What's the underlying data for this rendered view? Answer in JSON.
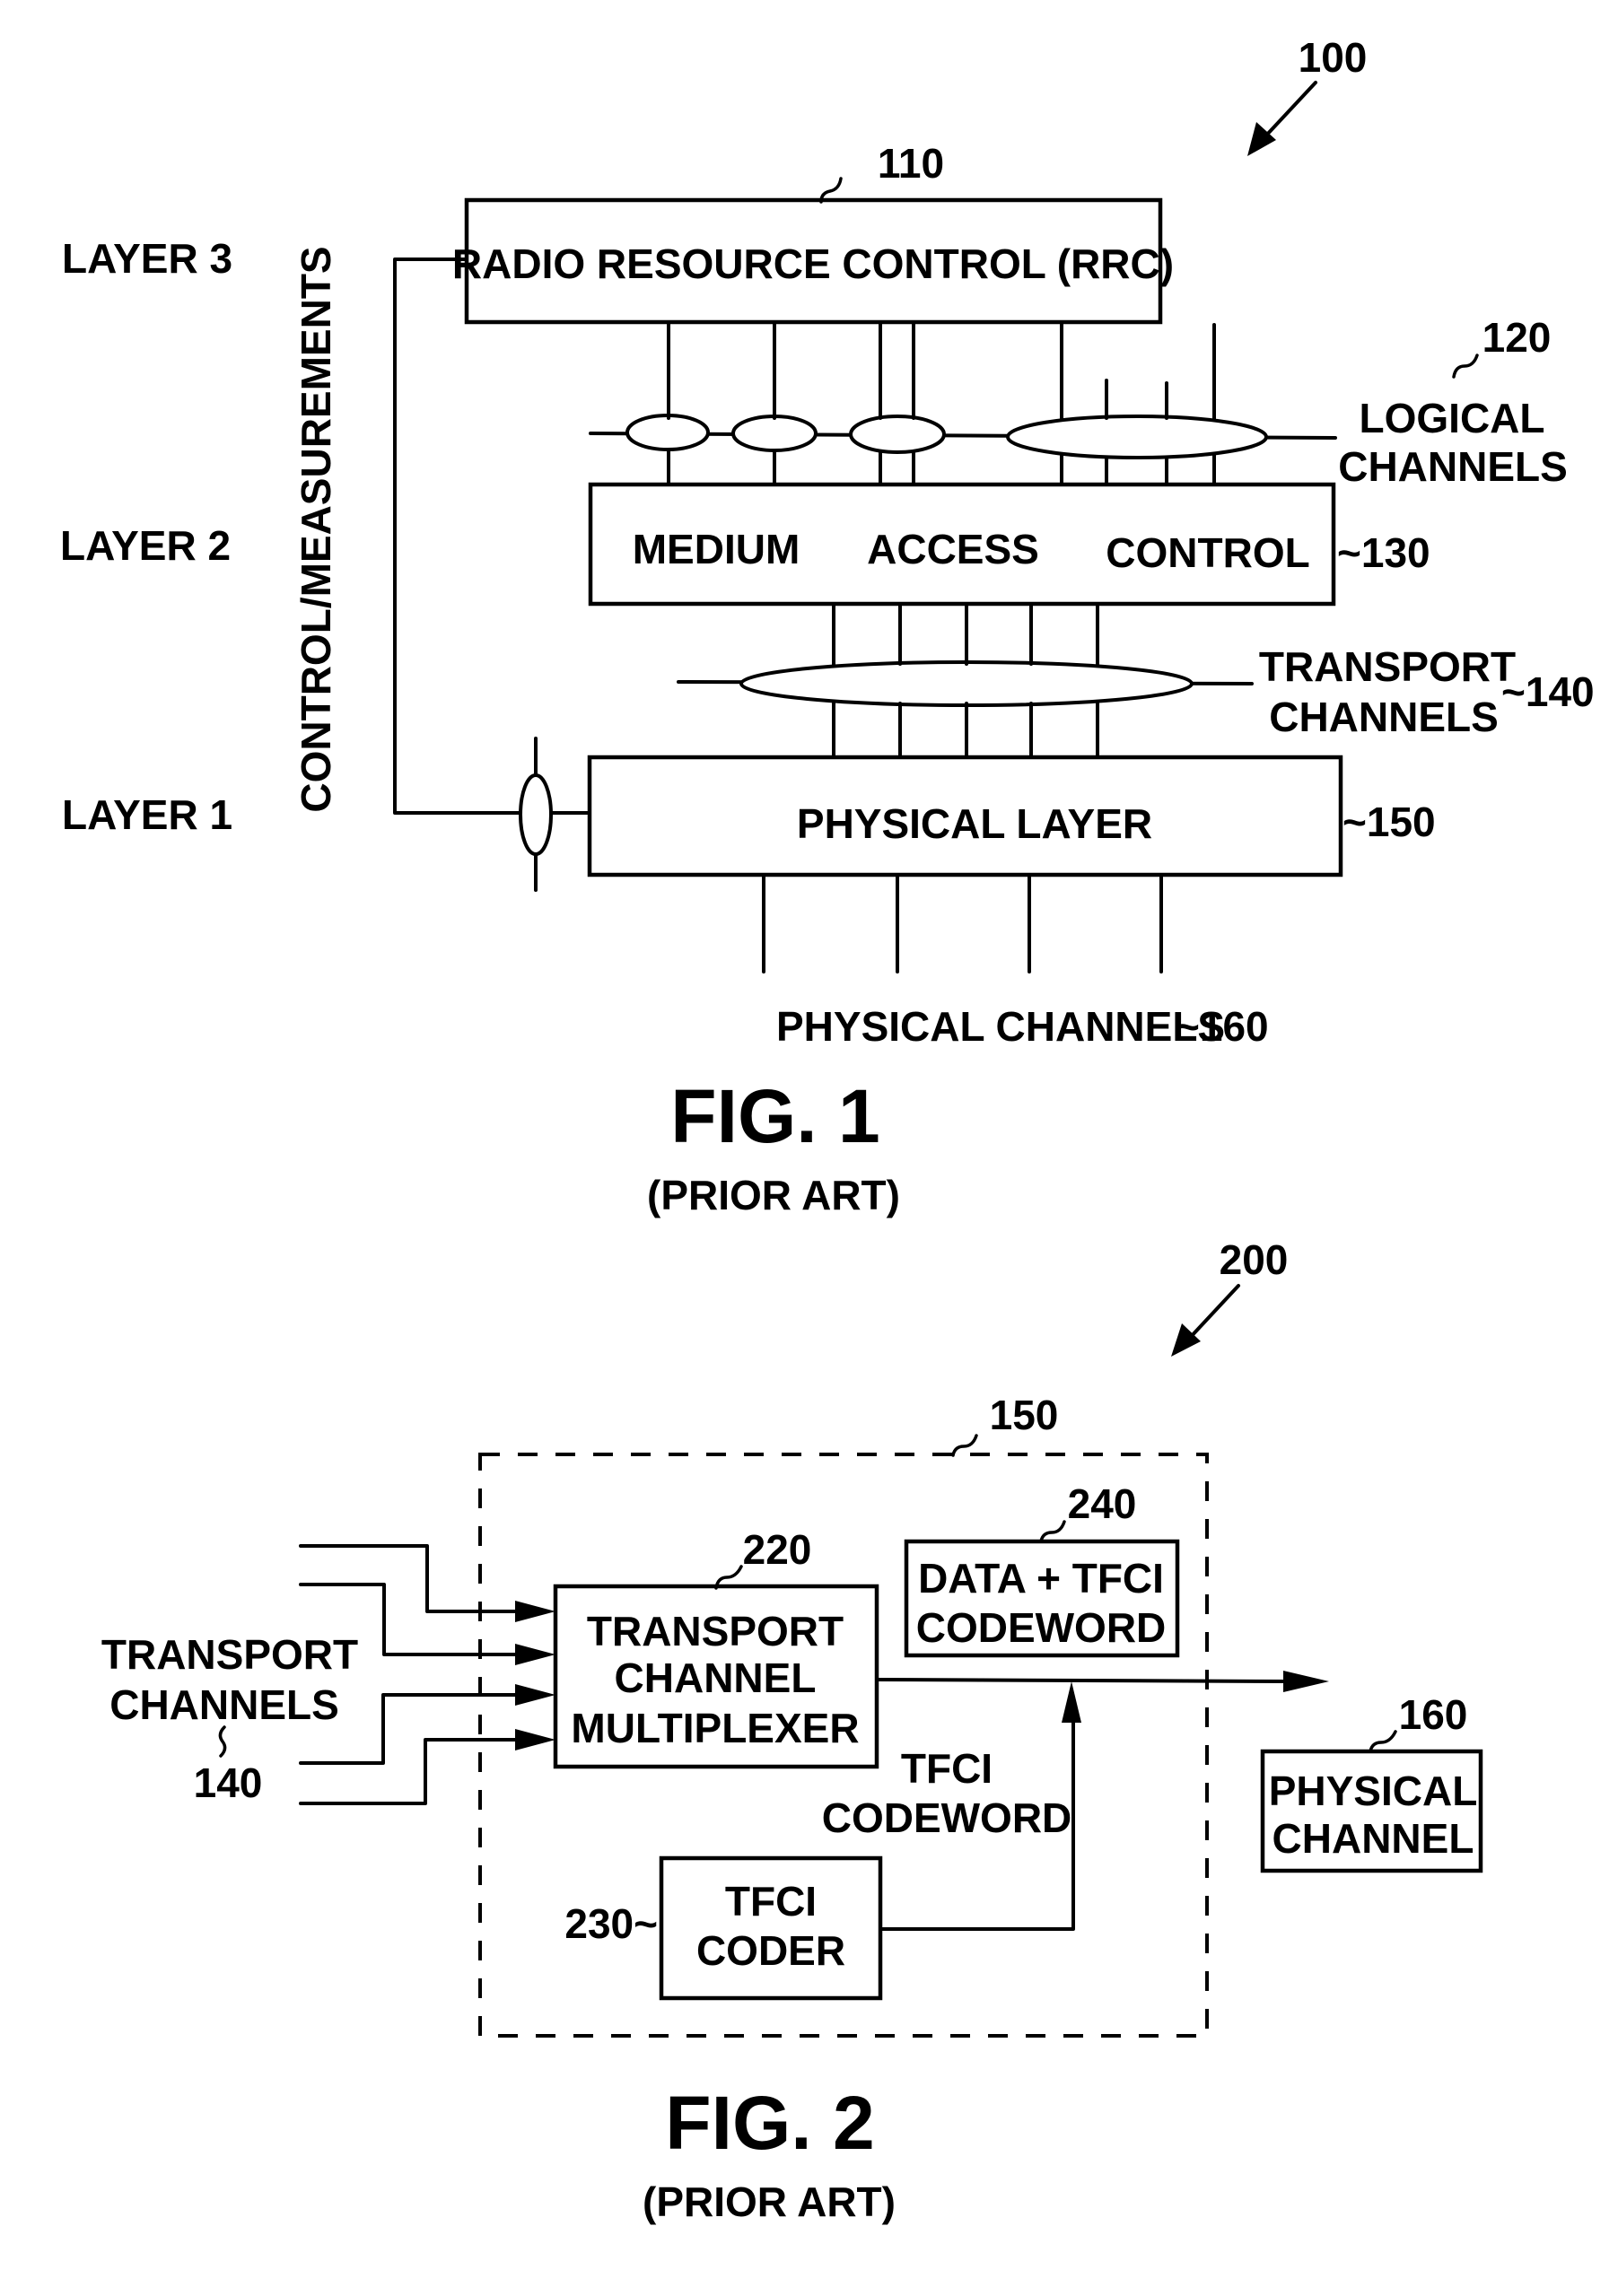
{
  "document": {
    "type": "patent drawing sheet",
    "colors": {
      "ink": "#000000",
      "paper": "#ffffff"
    }
  },
  "fig1": {
    "ref": "100",
    "layers": [
      "LAYER 3",
      "LAYER 2",
      "LAYER 1"
    ],
    "control_label": "CONTROL/MEASUREMENTS",
    "rrc": {
      "label": "RADIO RESOURCE CONTROL (RRC)",
      "ref": "110"
    },
    "logical_channels": {
      "line1": "LOGICAL",
      "line2": "CHANNELS",
      "ref": "120"
    },
    "mac": {
      "words": [
        "MEDIUM",
        "ACCESS",
        "CONTROL"
      ],
      "ref": "~130"
    },
    "transport_channels": {
      "line1": "TRANSPORT",
      "line2": "CHANNELS",
      "ref": "~140"
    },
    "phy": {
      "label": "PHYSICAL LAYER",
      "ref": "~150"
    },
    "physical_channels": {
      "label": "PHYSICAL CHANNELS",
      "ref": "~160"
    },
    "caption": "FIG. 1",
    "subcaption": "(PRIOR ART)"
  },
  "fig2": {
    "ref": "200",
    "phy_boundary_ref": "150",
    "inputs": {
      "line1": "TRANSPORT",
      "line2": "CHANNELS",
      "ref": "140",
      "count": 4
    },
    "mux": {
      "lines": [
        "TRANSPORT",
        "CHANNEL",
        "MULTIPLEXER"
      ],
      "ref": "220"
    },
    "data_tfci": {
      "lines": [
        "DATA + TFCI",
        "CODEWORD"
      ],
      "ref": "240"
    },
    "tfci_codeword": {
      "lines": [
        "TFCI",
        "CODEWORD"
      ]
    },
    "tfci_coder": {
      "lines": [
        "TFCI",
        "CODER"
      ],
      "ref": "230~"
    },
    "physical_channel": {
      "lines": [
        "PHYSICAL",
        "CHANNEL"
      ],
      "ref": "160"
    },
    "caption": "FIG. 2",
    "subcaption": "(PRIOR ART)"
  }
}
